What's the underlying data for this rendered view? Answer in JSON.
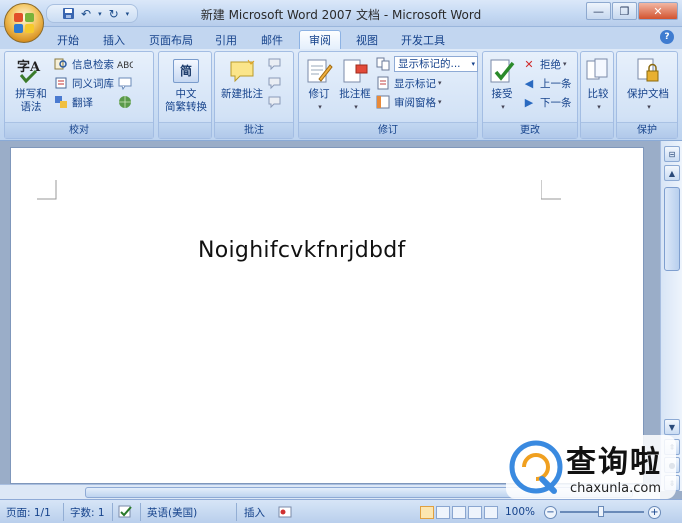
{
  "window": {
    "title": "新建 Microsoft Word 2007 文档 - Microsoft Word",
    "controls": [
      "minimize",
      "maximize",
      "close"
    ]
  },
  "quick_access": [
    "save",
    "undo",
    "redo",
    "customize"
  ],
  "tabs": [
    {
      "label": "开始",
      "active": false
    },
    {
      "label": "插入",
      "active": false
    },
    {
      "label": "页面布局",
      "active": false
    },
    {
      "label": "引用",
      "active": false
    },
    {
      "label": "邮件",
      "active": false
    },
    {
      "label": "审阅",
      "active": true
    },
    {
      "label": "视图",
      "active": false
    },
    {
      "label": "开发工具",
      "active": false
    }
  ],
  "ribbon": {
    "proofing": {
      "label": "校对",
      "spelling": "拼写和\n语法",
      "research": "信息检索",
      "thesaurus": "同义词库",
      "translate": "翻译"
    },
    "chinese": {
      "convert": "中文\n简繁转换",
      "icon_char": "简"
    },
    "comments": {
      "label": "批注",
      "new_comment": "新建批注"
    },
    "tracking": {
      "label": "修订",
      "track_changes": "修订",
      "balloons": "批注框",
      "display": "显示标记的...",
      "show_markup": "显示标记",
      "reviewing_pane": "审阅窗格"
    },
    "changes": {
      "label": "更改",
      "accept": "接受",
      "reject": "拒绝",
      "previous": "上一条",
      "next": "下一条"
    },
    "compare": {
      "label": "",
      "compare": "比较"
    },
    "protect": {
      "label": "保护",
      "protect_doc": "保护文档"
    }
  },
  "document": {
    "text": "Noighifcvkfnrjdbdf"
  },
  "statusbar": {
    "page": "页面: 1/1",
    "words": "字数: 1",
    "language": "英语(美国)",
    "insert": "插入",
    "zoom": "100%"
  },
  "watermark": {
    "title": "查询啦",
    "url": "chaxunla.com"
  }
}
